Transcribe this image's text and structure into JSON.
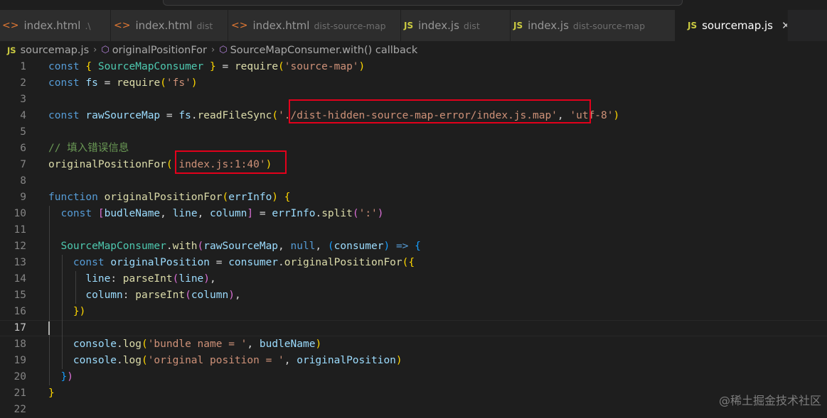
{
  "tabs": [
    {
      "name": "index.html",
      "desc": ".\\",
      "icon": "html-icon",
      "active": false
    },
    {
      "name": "index.html",
      "desc": "dist",
      "icon": "html-icon",
      "active": false
    },
    {
      "name": "index.html",
      "desc": "dist-source-map",
      "icon": "html-icon",
      "active": false
    },
    {
      "name": "index.js",
      "desc": "dist",
      "icon": "js-icon",
      "active": false
    },
    {
      "name": "index.js",
      "desc": "dist-source-map",
      "icon": "js-icon",
      "active": false
    },
    {
      "name": "sourcemap.js",
      "desc": "",
      "icon": "js-icon",
      "active": true
    }
  ],
  "icon_labels": {
    "js": "JS",
    "html": "<>",
    "close": "✕"
  },
  "breadcrumb": [
    "sourcemap.js",
    "originalPositionFor",
    "SourceMapConsumer.with() callback"
  ],
  "current_line": 17,
  "lines": [
    {
      "n": "1",
      "tokens": [
        [
          "k",
          "const "
        ],
        [
          "b1",
          "{ "
        ],
        [
          "t",
          "SourceMapConsumer"
        ],
        [
          "b1",
          " }"
        ],
        [
          "p",
          " = "
        ],
        [
          "f",
          "require"
        ],
        [
          "b1",
          "("
        ],
        [
          "s",
          "'source-map'"
        ],
        [
          "b1",
          ")"
        ]
      ]
    },
    {
      "n": "2",
      "tokens": [
        [
          "k",
          "const "
        ],
        [
          "v",
          "fs"
        ],
        [
          "p",
          " = "
        ],
        [
          "f",
          "require"
        ],
        [
          "b1",
          "("
        ],
        [
          "s",
          "'fs'"
        ],
        [
          "b1",
          ")"
        ]
      ]
    },
    {
      "n": "3",
      "tokens": []
    },
    {
      "n": "4",
      "tokens": [
        [
          "k",
          "const "
        ],
        [
          "v",
          "rawSourceMap"
        ],
        [
          "p",
          " = "
        ],
        [
          "v",
          "fs"
        ],
        [
          "p",
          "."
        ],
        [
          "f",
          "readFileSync"
        ],
        [
          "b1",
          "("
        ],
        [
          "s",
          "'./dist-hidden-source-map-error/index.js.map'"
        ],
        [
          "p",
          ", "
        ],
        [
          "s",
          "'utf-8'"
        ],
        [
          "b1",
          ")"
        ]
      ]
    },
    {
      "n": "5",
      "tokens": []
    },
    {
      "n": "6",
      "tokens": [
        [
          "c",
          "// 填入错误信息"
        ]
      ]
    },
    {
      "n": "7",
      "tokens": [
        [
          "f",
          "originalPositionFor"
        ],
        [
          "b1",
          "("
        ],
        [
          "s",
          "'index.js:1:40'"
        ],
        [
          "b1",
          ")"
        ]
      ]
    },
    {
      "n": "8",
      "tokens": []
    },
    {
      "n": "9",
      "tokens": [
        [
          "k",
          "function "
        ],
        [
          "f",
          "originalPositionFor"
        ],
        [
          "b1",
          "("
        ],
        [
          "v",
          "errInfo"
        ],
        [
          "b1",
          ")"
        ],
        [
          "p",
          " "
        ],
        [
          "b1",
          "{"
        ]
      ]
    },
    {
      "n": "10",
      "tokens": [
        [
          "p",
          "  "
        ],
        [
          "k",
          "const "
        ],
        [
          "b2",
          "["
        ],
        [
          "v",
          "budleName"
        ],
        [
          "p",
          ", "
        ],
        [
          "v",
          "line"
        ],
        [
          "p",
          ", "
        ],
        [
          "v",
          "column"
        ],
        [
          "b2",
          "]"
        ],
        [
          "p",
          " = "
        ],
        [
          "v",
          "errInfo"
        ],
        [
          "p",
          "."
        ],
        [
          "f",
          "split"
        ],
        [
          "b2",
          "("
        ],
        [
          "s",
          "':'"
        ],
        [
          "b2",
          ")"
        ]
      ]
    },
    {
      "n": "11",
      "tokens": []
    },
    {
      "n": "12",
      "tokens": [
        [
          "p",
          "  "
        ],
        [
          "t",
          "SourceMapConsumer"
        ],
        [
          "p",
          "."
        ],
        [
          "f",
          "with"
        ],
        [
          "b2",
          "("
        ],
        [
          "v",
          "rawSourceMap"
        ],
        [
          "p",
          ", "
        ],
        [
          "k",
          "null"
        ],
        [
          "p",
          ", "
        ],
        [
          "b3",
          "("
        ],
        [
          "v",
          "consumer"
        ],
        [
          "b3",
          ")"
        ],
        [
          "p",
          " "
        ],
        [
          "k",
          "=>"
        ],
        [
          "p",
          " "
        ],
        [
          "b3",
          "{"
        ]
      ]
    },
    {
      "n": "13",
      "tokens": [
        [
          "p",
          "    "
        ],
        [
          "k",
          "const "
        ],
        [
          "v",
          "originalPosition"
        ],
        [
          "p",
          " = "
        ],
        [
          "v",
          "consumer"
        ],
        [
          "p",
          "."
        ],
        [
          "f",
          "originalPositionFor"
        ],
        [
          "b1",
          "({"
        ]
      ]
    },
    {
      "n": "14",
      "tokens": [
        [
          "p",
          "      "
        ],
        [
          "v",
          "line"
        ],
        [
          "p",
          ": "
        ],
        [
          "f",
          "parseInt"
        ],
        [
          "b2",
          "("
        ],
        [
          "v",
          "line"
        ],
        [
          "b2",
          ")"
        ],
        [
          "p",
          ","
        ]
      ]
    },
    {
      "n": "15",
      "tokens": [
        [
          "p",
          "      "
        ],
        [
          "v",
          "column"
        ],
        [
          "p",
          ": "
        ],
        [
          "f",
          "parseInt"
        ],
        [
          "b2",
          "("
        ],
        [
          "v",
          "column"
        ],
        [
          "b2",
          ")"
        ],
        [
          "p",
          ","
        ]
      ]
    },
    {
      "n": "16",
      "tokens": [
        [
          "p",
          "    "
        ],
        [
          "b1",
          "})"
        ]
      ]
    },
    {
      "n": "17",
      "tokens": []
    },
    {
      "n": "18",
      "tokens": [
        [
          "p",
          "    "
        ],
        [
          "v",
          "console"
        ],
        [
          "p",
          "."
        ],
        [
          "f",
          "log"
        ],
        [
          "b1",
          "("
        ],
        [
          "s",
          "'bundle name = '"
        ],
        [
          "p",
          ", "
        ],
        [
          "v",
          "budleName"
        ],
        [
          "b1",
          ")"
        ]
      ]
    },
    {
      "n": "19",
      "tokens": [
        [
          "p",
          "    "
        ],
        [
          "v",
          "console"
        ],
        [
          "p",
          "."
        ],
        [
          "f",
          "log"
        ],
        [
          "b1",
          "("
        ],
        [
          "s",
          "'original position = '"
        ],
        [
          "p",
          ", "
        ],
        [
          "v",
          "originalPosition"
        ],
        [
          "b1",
          ")"
        ]
      ]
    },
    {
      "n": "20",
      "tokens": [
        [
          "p",
          "  "
        ],
        [
          "b3",
          "}"
        ],
        [
          "b2",
          ")"
        ]
      ]
    },
    {
      "n": "21",
      "tokens": [
        [
          "b1",
          "}"
        ]
      ]
    },
    {
      "n": "22",
      "tokens": []
    }
  ],
  "watermark": "@稀土掘金技术社区"
}
